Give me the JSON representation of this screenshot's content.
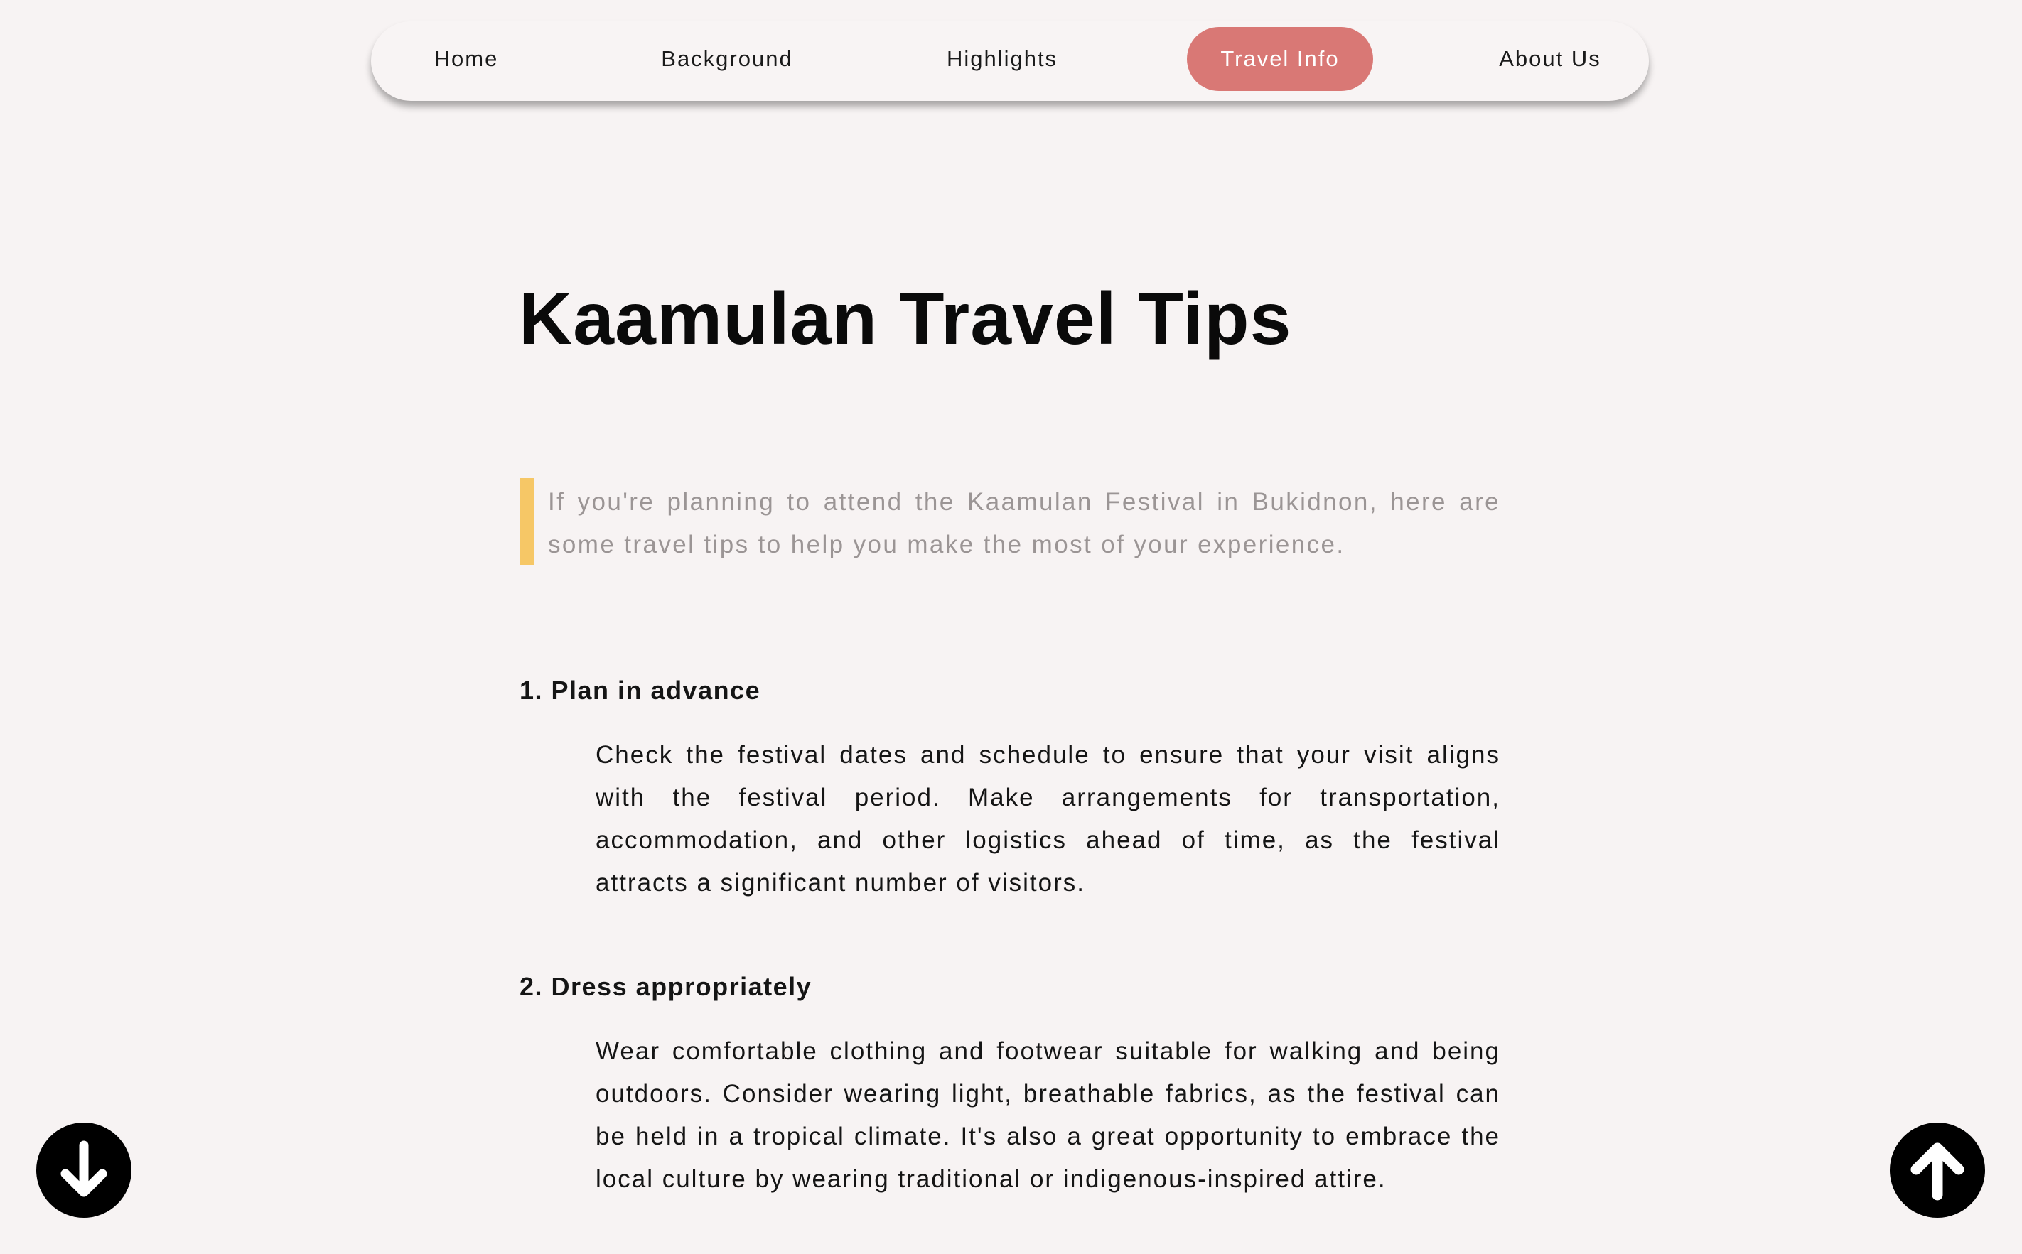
{
  "nav": {
    "items": [
      {
        "label": "Home"
      },
      {
        "label": "Background"
      },
      {
        "label": "Highlights"
      },
      {
        "label": "Travel Info",
        "active": true
      },
      {
        "label": "About Us"
      }
    ],
    "active_color": "#d97875"
  },
  "main": {
    "title": "Kaamulan Travel Tips",
    "intro": "If you're planning to attend the Kaamulan Festival in Bukidnon, here are some travel tips to help you make the most of your experience.",
    "intro_accent_color": "#f6c766",
    "tips": [
      {
        "heading": "1. Plan in advance",
        "body": "Check the festival dates and schedule to ensure that your visit aligns with the festival period. Make arrangements for transportation, accommodation, and other logistics ahead of time, as the festival attracts a significant number of visitors."
      },
      {
        "heading": "2. Dress appropriately",
        "body": "Wear comfortable clothing and footwear suitable for walking and being outdoors. Consider wearing light, breathable fabrics, as the festival can be held in a tropical climate. It's also a great opportunity to embrace the local culture by wearing traditional or indigenous-inspired attire."
      }
    ]
  },
  "controls": {
    "scroll_down_icon": "arrow-down-icon",
    "scroll_up_icon": "arrow-up-icon"
  }
}
